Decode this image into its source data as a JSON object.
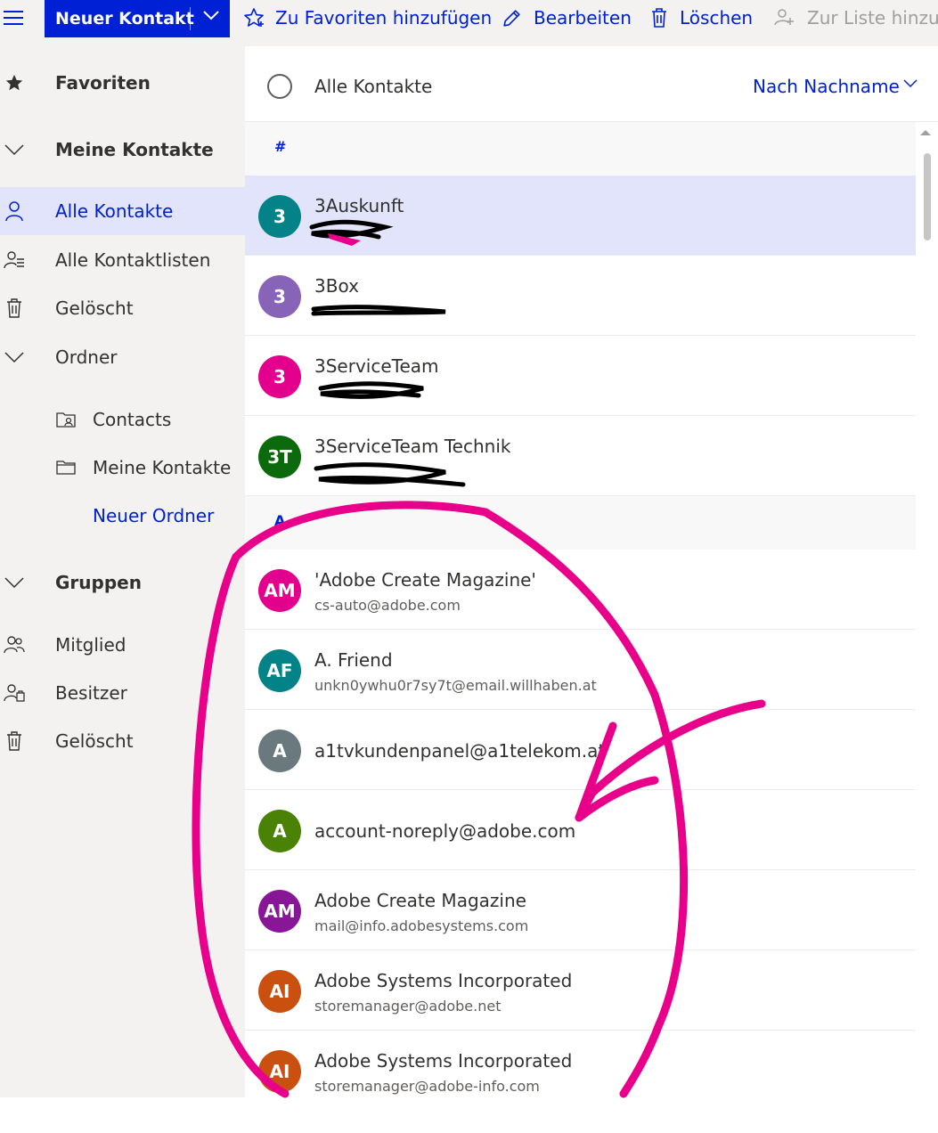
{
  "toolbar": {
    "new_contact": "Neuer Kontakt",
    "favorite": "Zu Favoriten hinzufügen",
    "edit": "Bearbeiten",
    "delete": "Löschen",
    "add_to_list": "Zur Liste hinzufü"
  },
  "sidebar": {
    "favorites": "Favoriten",
    "my_contacts": "Meine Kontakte",
    "all_contacts": "Alle Kontakte",
    "all_contact_lists": "Alle Kontaktlisten",
    "deleted": "Gelöscht",
    "folders": "Ordner",
    "folder_contacts": "Contacts",
    "folder_my_contacts": "Meine Kontakte",
    "new_folder": "Neuer Ordner",
    "groups": "Gruppen",
    "member": "Mitglied",
    "owner": "Besitzer",
    "groups_deleted": "Gelöscht"
  },
  "list": {
    "title": "Alle Kontakte",
    "sort": "Nach Nachname",
    "sections": [
      "#",
      "A"
    ],
    "contacts": [
      {
        "initials": "3",
        "name": "3Auskunft",
        "detail": "",
        "color": "#038387"
      },
      {
        "initials": "3",
        "name": "3Box",
        "detail": "",
        "color": "#8764b8"
      },
      {
        "initials": "3",
        "name": "3ServiceTeam",
        "detail": "",
        "color": "#e3008c"
      },
      {
        "initials": "3T",
        "name": "3ServiceTeam Technik",
        "detail": "",
        "color": "#0b6a0b"
      },
      {
        "initials": "AM",
        "name": "'Adobe Create Magazine'",
        "detail": "cs-auto@adobe.com",
        "color": "#e3008c"
      },
      {
        "initials": "AF",
        "name": "A. Friend",
        "detail": "unkn0ywhu0r7sy7t@email.willhaben.at",
        "color": "#038387"
      },
      {
        "initials": "A",
        "name": "a1tvkundenpanel@a1telekom.at",
        "detail": "",
        "color": "#69797e"
      },
      {
        "initials": "A",
        "name": "account-noreply@adobe.com",
        "detail": "",
        "color": "#498205"
      },
      {
        "initials": "AM",
        "name": "Adobe Create Magazine",
        "detail": "mail@info.adobesystems.com",
        "color": "#881798"
      },
      {
        "initials": "AI",
        "name": "Adobe Systems Incorporated",
        "detail": "storemanager@adobe.net",
        "color": "#ca5010"
      },
      {
        "initials": "AI",
        "name": "Adobe Systems Incorporated",
        "detail": "storemanager@adobe-info.com",
        "color": "#ca5010"
      }
    ]
  },
  "colors": {
    "accent": "#0020d6",
    "annotation": "#e8008a"
  },
  "icons": [
    "hamburger-icon",
    "chevron-down-icon",
    "star-outline-icon",
    "pencil-icon",
    "trash-icon",
    "add-to-list-icon",
    "star-icon",
    "person-icon",
    "contact-list-icon",
    "folder-contacts-icon",
    "folder-icon",
    "group-member-icon",
    "group-owner-icon"
  ]
}
